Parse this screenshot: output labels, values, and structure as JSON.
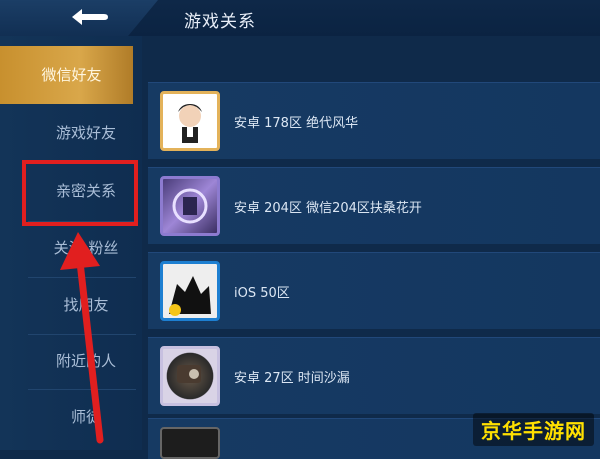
{
  "header": {
    "title": "游戏关系"
  },
  "sidebar": {
    "items": [
      {
        "label": "微信好友",
        "active": true
      },
      {
        "label": "游戏好友",
        "active": false
      },
      {
        "label": "亲密关系",
        "active": false,
        "highlighted": true
      },
      {
        "label": "关注 粉丝",
        "active": false
      },
      {
        "label": "找朋友",
        "active": false
      },
      {
        "label": "附近的人",
        "active": false
      },
      {
        "label": "师徒",
        "active": false
      }
    ]
  },
  "friends": [
    {
      "server": "安卓 178区 绝代风华"
    },
    {
      "server": "安卓 204区 微信204区扶桑花开"
    },
    {
      "server": "iOS 50区"
    },
    {
      "server": "安卓 27区 时间沙漏"
    },
    {
      "server": ""
    }
  ],
  "watermark": {
    "text": "京华手游网"
  },
  "colors": {
    "annotation": "#e11f1f",
    "active_tab": "#d9a74a",
    "background": "#0f2a4a"
  }
}
